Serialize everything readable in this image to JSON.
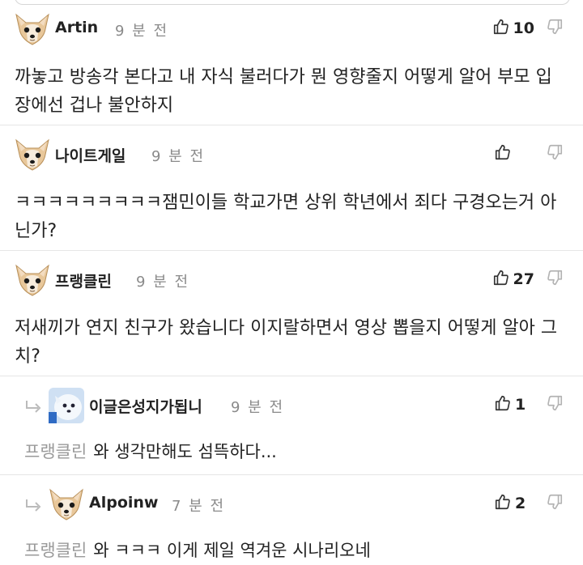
{
  "comments": [
    {
      "type": "top",
      "author": "Artin",
      "time": "9 분 전",
      "likes": "10",
      "text": "까놓고 방송각 본다고 내 자식 불러다가 뭔 영향줄지 어떻게 알어 부모 입장에선 겁나 불안하지",
      "avatar": "dog-face-avatar"
    },
    {
      "type": "top",
      "author": "나이트게일",
      "time": "9 분 전",
      "likes": "",
      "text": "ㅋㅋㅋㅋㅋㅋㅋㅋㅋ잼민이들 학교가면 상위 학년에서 죄다 구경오는거 아닌가?",
      "avatar": "dog-face-avatar"
    },
    {
      "type": "top",
      "author": "프랭클린",
      "time": "9 분 전",
      "likes": "27",
      "text": "저새끼가 연지 친구가 왔습니다 이지랄하면서 영상 뽑을지 어떻게 알아 그치?",
      "avatar": "dog-face-avatar"
    },
    {
      "type": "reply",
      "author": "이글은성지가됩니",
      "time": "9 분 전",
      "likes": "1",
      "mention": "프랭클린",
      "text": "와 생각만해도 섬뜩하다...",
      "avatar": "white-animal-avatar"
    },
    {
      "type": "reply",
      "author": "Alpoinw",
      "time": "7 분 전",
      "likes": "2",
      "mention": "프랭클린",
      "text": "와 ㅋㅋㅋ 이게 제일 역겨운 시나리오네",
      "avatar": "dog-face-avatar"
    }
  ],
  "icons": {
    "like": "thumbs-up-icon",
    "dislike": "thumbs-down-icon",
    "reply": "reply-arrow-icon"
  },
  "colors": {
    "text": "#222222",
    "meta": "#8a8a8a",
    "mention": "#9a9a9a",
    "divider": "#e6e6e6"
  }
}
